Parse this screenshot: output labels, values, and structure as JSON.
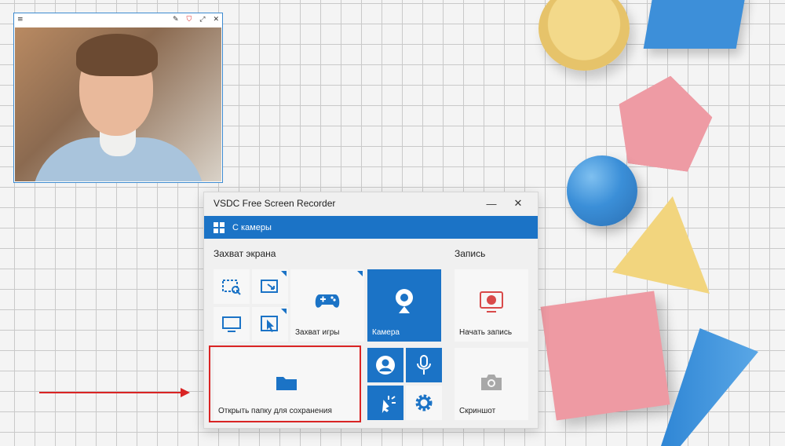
{
  "camera_window": {
    "title_buttons": [
      "≡",
      "✎",
      "⛉",
      "⤢",
      "✕"
    ]
  },
  "recorder": {
    "title": "VSDC Free Screen Recorder",
    "minimize_glyph": "—",
    "close_glyph": "✕",
    "mode_label": "С камеры",
    "section_capture": "Захват экрана",
    "section_record": "Запись",
    "tiles": {
      "game_capture": "Захват игры",
      "camera": "Камера",
      "open_folder": "Открыть папку для сохранения",
      "start_record": "Начать запись",
      "screenshot": "Скриншот"
    }
  },
  "colors": {
    "accent": "#1b73c6",
    "highlight": "#d92424",
    "record_red": "#d94a4a"
  },
  "icons": [
    "region-capture-icon",
    "window-capture-icon",
    "fullscreen-icon",
    "cursor-capture-icon",
    "gamepad-icon",
    "webcam-icon",
    "person-icon",
    "microphone-icon",
    "cursor-effect-icon",
    "settings-gear-icon",
    "folder-icon",
    "record-icon",
    "camera-icon"
  ]
}
